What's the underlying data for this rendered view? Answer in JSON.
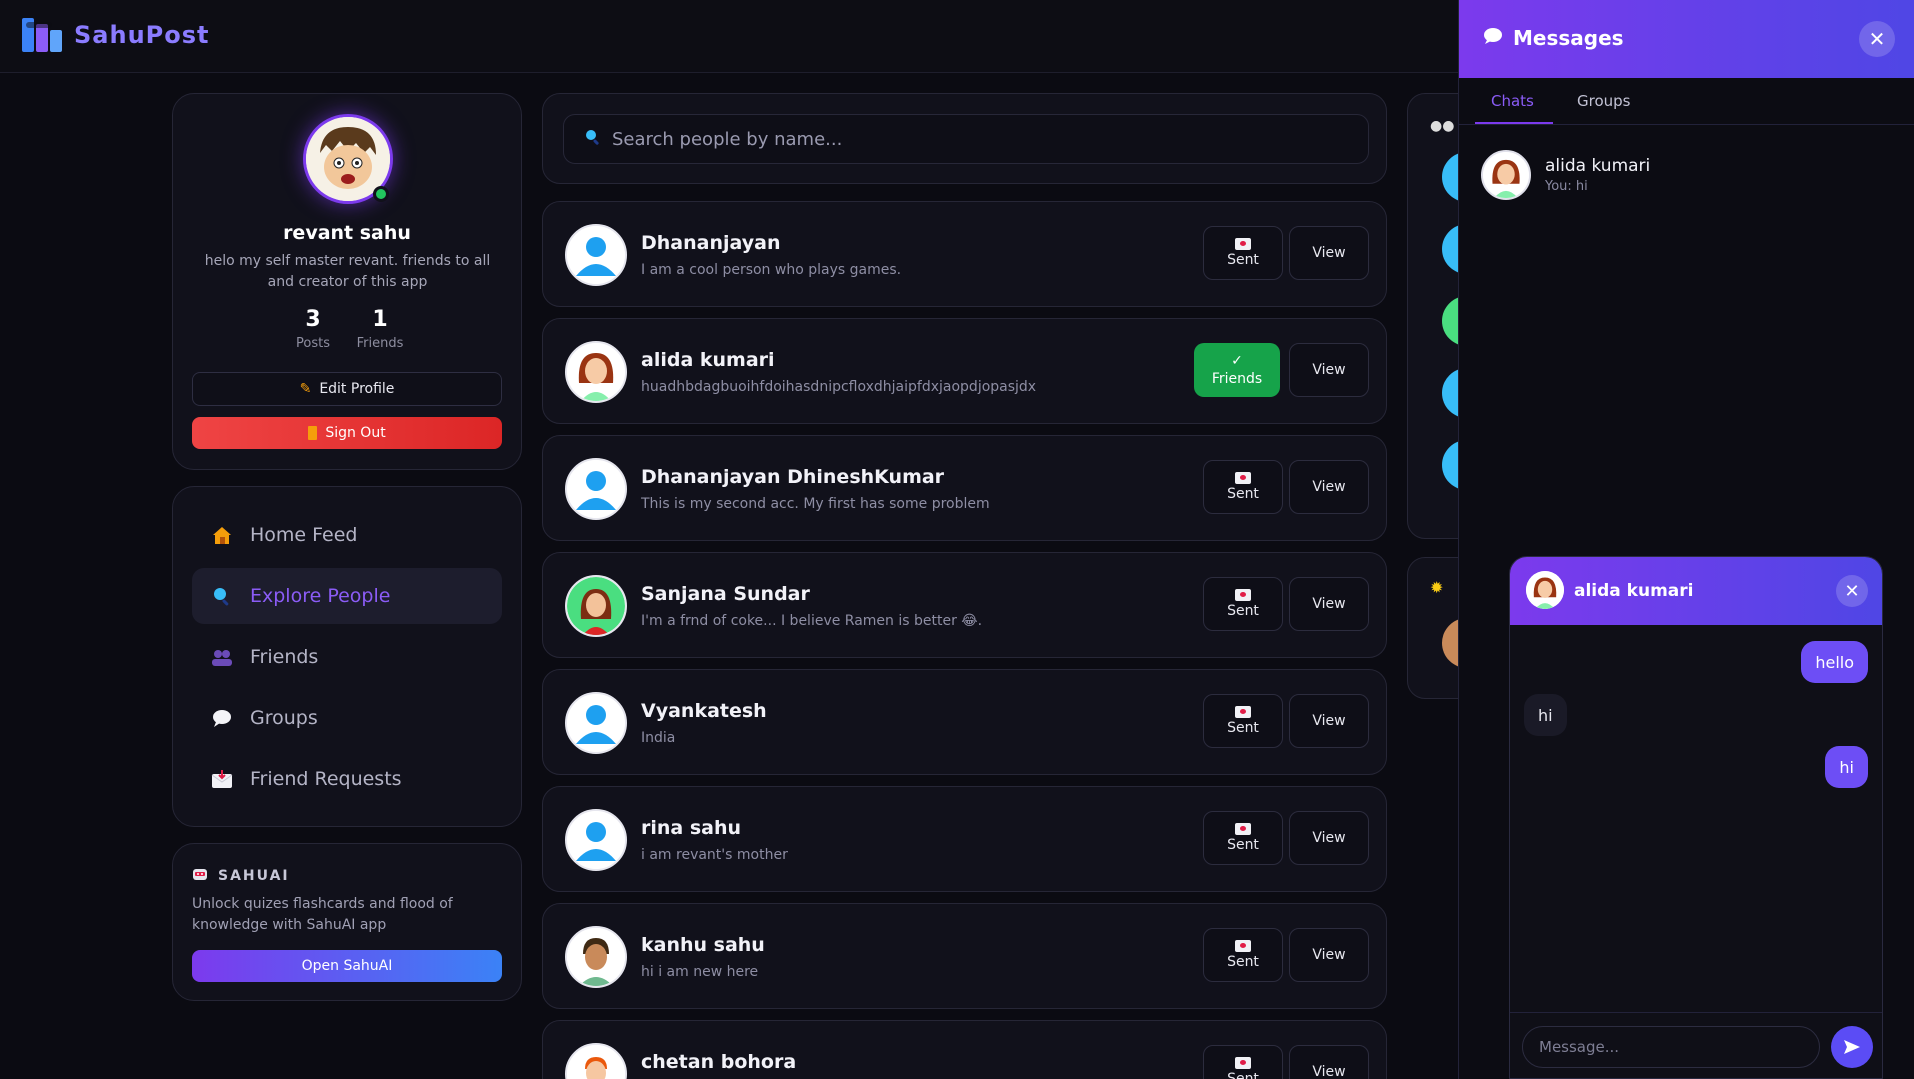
{
  "app": {
    "name": "SahuPost"
  },
  "profile": {
    "name": "revant sahu",
    "bio": "helo my self master revant. friends to all and creator of this app",
    "posts_count": "3",
    "posts_label": "Posts",
    "friends_count": "1",
    "friends_label": "Friends",
    "edit_label": "Edit Profile",
    "signout_label": "Sign Out"
  },
  "nav": [
    {
      "label": "Home Feed",
      "icon": "house-icon"
    },
    {
      "label": "Explore People",
      "icon": "magnifier-icon",
      "active": true
    },
    {
      "label": "Friends",
      "icon": "users-icon"
    },
    {
      "label": "Groups",
      "icon": "speech-bubble-icon"
    },
    {
      "label": "Friend Requests",
      "icon": "envelope-icon"
    }
  ],
  "sahuai": {
    "title": "SAHUAI",
    "desc": "Unlock quizes flashcards and flood of knowledge with SahuAI app",
    "button": "Open SahuAI"
  },
  "search": {
    "placeholder": "Search people by name..."
  },
  "people": [
    {
      "name": "Dhananjayan",
      "bio": "I am a cool person who plays games.",
      "status": "Sent",
      "view": "View"
    },
    {
      "name": "alida kumari",
      "bio": "huadhbdagbuoihfdoihasdnipcfloxdhjaipfdxjaopdjopasjdx",
      "status": "Friends",
      "status_icon": "✓",
      "view": "View"
    },
    {
      "name": "Dhananjayan DhineshKumar",
      "bio": "This is my second acc. My first has some problem",
      "status": "Sent",
      "view": "View"
    },
    {
      "name": "Sanjana Sundar",
      "bio": "I'm a frnd of coke... I believe Ramen is better 😂.",
      "status": "Sent",
      "view": "View"
    },
    {
      "name": "Vyankatesh",
      "bio": "India",
      "status": "Sent",
      "view": "View"
    },
    {
      "name": "rina sahu",
      "bio": "i am revant's mother",
      "status": "Sent",
      "view": "View"
    },
    {
      "name": "kanhu sahu",
      "bio": "hi i am new here",
      "status": "Sent",
      "view": "View"
    },
    {
      "name": "chetan bohora",
      "bio": "",
      "status": "Sent",
      "view": "View"
    }
  ],
  "messages": {
    "title": "Messages",
    "tabs": [
      "Chats",
      "Groups"
    ],
    "chats": [
      {
        "name": "alida kumari",
        "last": "You: hi"
      }
    ]
  },
  "chat_window": {
    "name": "alida kumari",
    "messages": [
      {
        "from": "me",
        "text": "hello"
      },
      {
        "from": "them",
        "text": "hi"
      },
      {
        "from": "me",
        "text": "hi"
      }
    ],
    "input_placeholder": "Message..."
  },
  "colors": {
    "accent": "#7c3aed",
    "accent2": "#4f46e5",
    "friends_green": "#16a34a",
    "danger": "#ef4444",
    "bg": "#0b0b12"
  }
}
